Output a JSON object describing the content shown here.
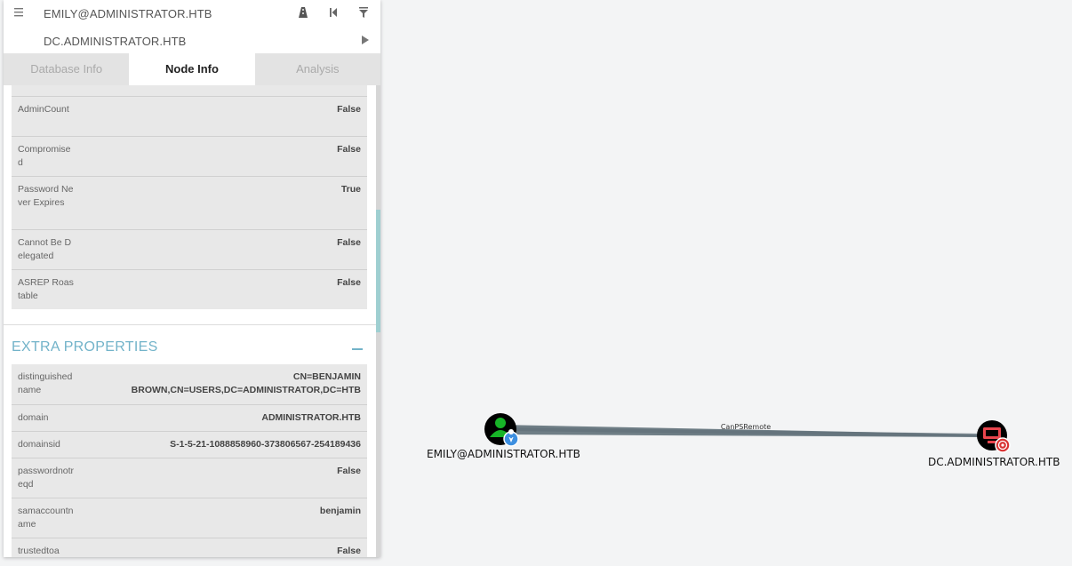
{
  "search": {
    "start_node": "EMILY@ADMINISTRATOR.HTB",
    "target_node": "DC.ADMINISTRATOR.HTB"
  },
  "tabs": [
    {
      "label": "Database Info",
      "active": false
    },
    {
      "label": "Node Info",
      "active": true
    },
    {
      "label": "Analysis",
      "active": false
    }
  ],
  "properties": [
    {
      "key": "AdminCount",
      "value": "False"
    },
    {
      "key": "Compromised",
      "value": "False"
    },
    {
      "key": "Password Never Expires",
      "value": "True"
    },
    {
      "key": "Cannot Be Delegated",
      "value": "False"
    },
    {
      "key": "ASREP Roastable",
      "value": "False"
    }
  ],
  "extra": {
    "title": "EXTRA PROPERTIES",
    "rows": [
      {
        "key": "distinguishedname",
        "value": "CN=BENJAMIN BROWN,CN=USERS,DC=ADMINISTRATOR,DC=HTB"
      },
      {
        "key": "domain",
        "value": "ADMINISTRATOR.HTB"
      },
      {
        "key": "domainsid",
        "value": "S-1-5-21-1088858960-373806567-254189436"
      },
      {
        "key": "passwordnotreqd",
        "value": "False"
      },
      {
        "key": "samaccountname",
        "value": "benjamin"
      },
      {
        "key": "trustedtoa",
        "value": "False"
      }
    ]
  },
  "graph": {
    "source_label": "EMILY@ADMINISTRATOR.HTB",
    "target_label": "DC.ADMINISTRATOR.HTB",
    "edge_label": "CanPSRemote",
    "colors": {
      "user_node": "#17b427",
      "computer_node": "#e8454d",
      "edge": "#5f6f78",
      "start_marker": "#3d8fe0",
      "target_marker": "#d93232"
    }
  },
  "icons": [
    "menu-icon",
    "pathfinding-icon",
    "back-icon",
    "filter-icon",
    "play-icon",
    "collapse-icon"
  ]
}
